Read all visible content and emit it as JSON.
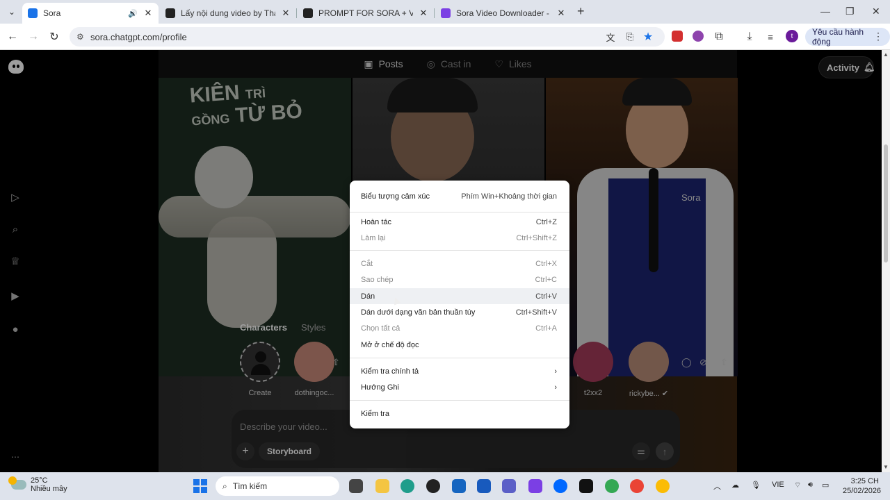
{
  "browser": {
    "tabs": [
      {
        "title": "Sora",
        "active": true,
        "favicon_color": "#1a73e8"
      },
      {
        "title": "Lấy nội dung video by Thạch B",
        "active": false,
        "favicon_color": "#222222"
      },
      {
        "title": "PROMPT FOR SORA + VEO | Go",
        "active": false,
        "favicon_color": "#222222"
      },
      {
        "title": "Sora Video Downloader - Tải V",
        "active": false,
        "favicon_color": "#7b3fe4"
      }
    ],
    "url": "sora.chatgpt.com/profile",
    "update_button": "Yêu cầu hành động",
    "profile_initial": "t"
  },
  "sora": {
    "tabs": [
      {
        "label": "Posts",
        "icon": "play-square-icon"
      },
      {
        "label": "Cast in",
        "icon": "person-circle-icon"
      },
      {
        "label": "Likes",
        "icon": "heart-icon"
      }
    ],
    "activity_label": "Activity",
    "poster": {
      "line1": "KIÊN",
      "line1b": "TRÌ",
      "line2a": "GỒNG",
      "line2b": "TỪ BỎ"
    },
    "watermark": "Sora",
    "character_tabs": [
      "Characters",
      "Styles"
    ],
    "characters": [
      {
        "name": "Create"
      },
      {
        "name": "dothingoc..."
      },
      {
        "name": "t2xx2"
      },
      {
        "name": "rickybe..."
      }
    ],
    "prompt_placeholder": "Describe your video...",
    "storyboard_label": "Storyboard"
  },
  "context_menu": {
    "items": [
      {
        "label": "Biểu tượng cảm xúc",
        "shortcut": "Phím Win+Khoảng thời gian",
        "disabled": false
      },
      {
        "label": "Hoàn tác",
        "shortcut": "Ctrl+Z",
        "disabled": false
      },
      {
        "label": "Làm lại",
        "shortcut": "Ctrl+Shift+Z",
        "disabled": true
      },
      {
        "label": "Cắt",
        "shortcut": "Ctrl+X",
        "disabled": true
      },
      {
        "label": "Sao chép",
        "shortcut": "Ctrl+C",
        "disabled": true
      },
      {
        "label": "Dán",
        "shortcut": "Ctrl+V",
        "disabled": false
      },
      {
        "label": "Dán dưới dạng văn bản thuần túy",
        "shortcut": "Ctrl+Shift+V",
        "disabled": false
      },
      {
        "label": "Chọn tất cả",
        "shortcut": "Ctrl+A",
        "disabled": true
      },
      {
        "label": "Mở ở chế độ đọc",
        "shortcut": "",
        "disabled": false
      },
      {
        "label": "Kiểm tra chính tả",
        "shortcut": "",
        "disabled": false
      },
      {
        "label": "Hướng Ghi",
        "shortcut": "",
        "disabled": false
      },
      {
        "label": "Kiểm tra",
        "shortcut": "",
        "disabled": false
      }
    ]
  },
  "taskbar": {
    "temperature": "25°C",
    "weather": "Nhiều mây",
    "search_placeholder": "Tìm kiếm",
    "language": "VIE",
    "time": "3:25 CH",
    "date": "25/02/2026"
  }
}
